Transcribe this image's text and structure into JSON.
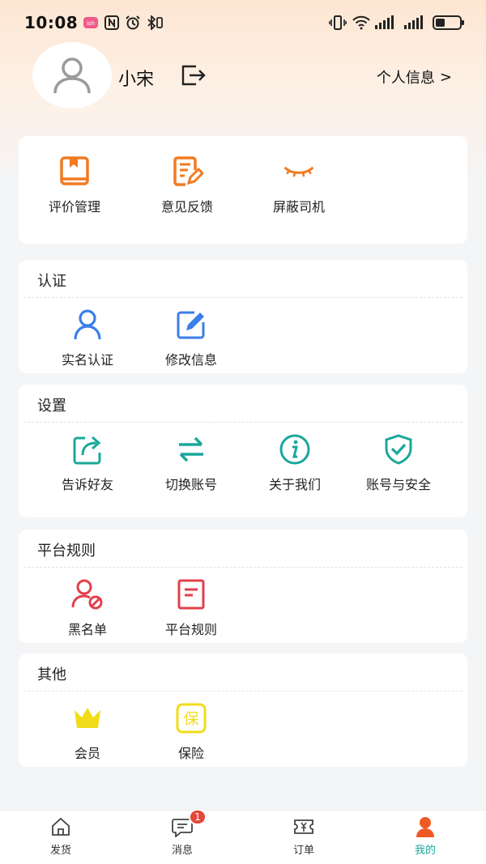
{
  "status_bar": {
    "time": "10:08",
    "icons": [
      "app-notification-icon",
      "nfc-icon",
      "alarm-icon",
      "bluetooth-icon",
      "vibrate-icon",
      "wifi-icon",
      "signal-icon",
      "signal-icon",
      "battery-icon"
    ],
    "battery_level": 0.4
  },
  "profile": {
    "name": "小宋",
    "personal_info_label": "个人信息",
    "chevron": ">"
  },
  "quick_actions": {
    "items": [
      {
        "label": "评价管理",
        "icon": "book-icon",
        "color": "#f07b22"
      },
      {
        "label": "意见反馈",
        "icon": "edit-note-icon",
        "color": "#f07b22"
      },
      {
        "label": "屏蔽司机",
        "icon": "closed-eye-icon",
        "color": "#f07b22"
      }
    ]
  },
  "sections": {
    "auth": {
      "title": "认证",
      "items": [
        {
          "label": "实名认证",
          "icon": "user-icon",
          "color": "#3b7ee8"
        },
        {
          "label": "修改信息",
          "icon": "edit-icon",
          "color": "#3b7ee8"
        }
      ]
    },
    "settings": {
      "title": "设置",
      "items": [
        {
          "label": "告诉好友",
          "icon": "share-icon",
          "color": "#1aa89a"
        },
        {
          "label": "切换账号",
          "icon": "switch-icon",
          "color": "#1aa89a"
        },
        {
          "label": "关于我们",
          "icon": "info-icon",
          "color": "#1aa89a"
        },
        {
          "label": "账号与安全",
          "icon": "shield-check-icon",
          "color": "#1aa89a"
        }
      ]
    },
    "rules": {
      "title": "平台规则",
      "items": [
        {
          "label": "黑名单",
          "icon": "blocked-user-icon",
          "color": "#e2404b"
        },
        {
          "label": "平台规则",
          "icon": "document-icon",
          "color": "#e2404b"
        }
      ]
    },
    "other": {
      "title": "其他",
      "items": [
        {
          "label": "会员",
          "icon": "crown-icon",
          "color": "#f2dc1a"
        },
        {
          "label": "保险",
          "icon": "insurance-icon",
          "color": "#f2dc1a",
          "glyph": "保"
        }
      ]
    }
  },
  "tabbar": {
    "tabs": [
      {
        "label": "发货",
        "icon": "home-icon"
      },
      {
        "label": "消息",
        "icon": "message-icon",
        "badge": "1"
      },
      {
        "label": "订单",
        "icon": "order-ticket-icon"
      },
      {
        "label": "我的",
        "icon": "profile-icon",
        "active": true
      }
    ],
    "active_color": "#19a79b"
  }
}
